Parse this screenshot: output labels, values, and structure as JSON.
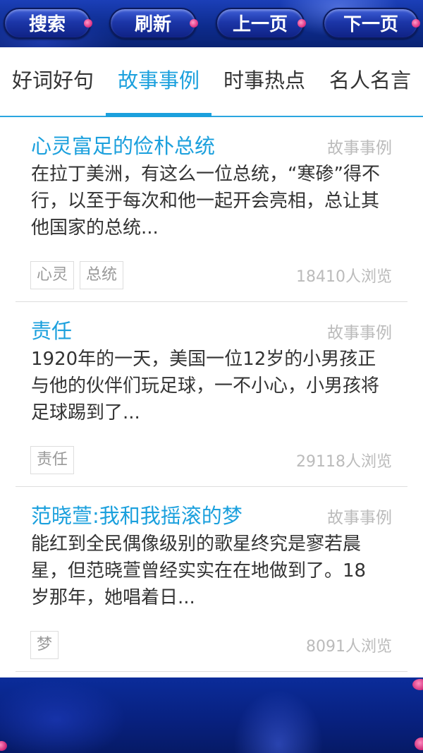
{
  "toolbar": {
    "search_label": "搜索",
    "refresh_label": "刷新",
    "prev_label": "上一页",
    "next_label": "下一页"
  },
  "tabs": [
    {
      "label": "好词好句",
      "active": false
    },
    {
      "label": "故事事例",
      "active": true
    },
    {
      "label": "时事热点",
      "active": false
    },
    {
      "label": "名人名言",
      "active": false
    }
  ],
  "articles": [
    {
      "title": "心灵富足的俭朴总统",
      "category": "故事事例",
      "summary": "在拉丁美洲，有这么一位总统，“寒碜”得不行，以至于每次和他一起开会亮相，总让其他国家的总统...",
      "tags": [
        "心灵",
        "总统"
      ],
      "views": "18410人浏览"
    },
    {
      "title": "责任",
      "category": "故事事例",
      "summary": "1920年的一天，美国一位12岁的小男孩正与他的伙伴们玩足球，一不小心，小男孩将足球踢到了...",
      "tags": [
        "责任"
      ],
      "views": "29118人浏览"
    },
    {
      "title": "范晓萱:我和我摇滚的梦",
      "category": "故事事例",
      "summary": "能红到全民偶像级别的歌星终究是寥若晨星，但范晓萱曾经实实在在地做到了。18岁那年，她唱着日...",
      "tags": [
        "梦"
      ],
      "views": "8091人浏览"
    }
  ],
  "colors": {
    "accent": "#1ba0dd",
    "toolbar_bg": "#0c2a8a",
    "text": "#333333",
    "muted": "#bbbbbb"
  }
}
